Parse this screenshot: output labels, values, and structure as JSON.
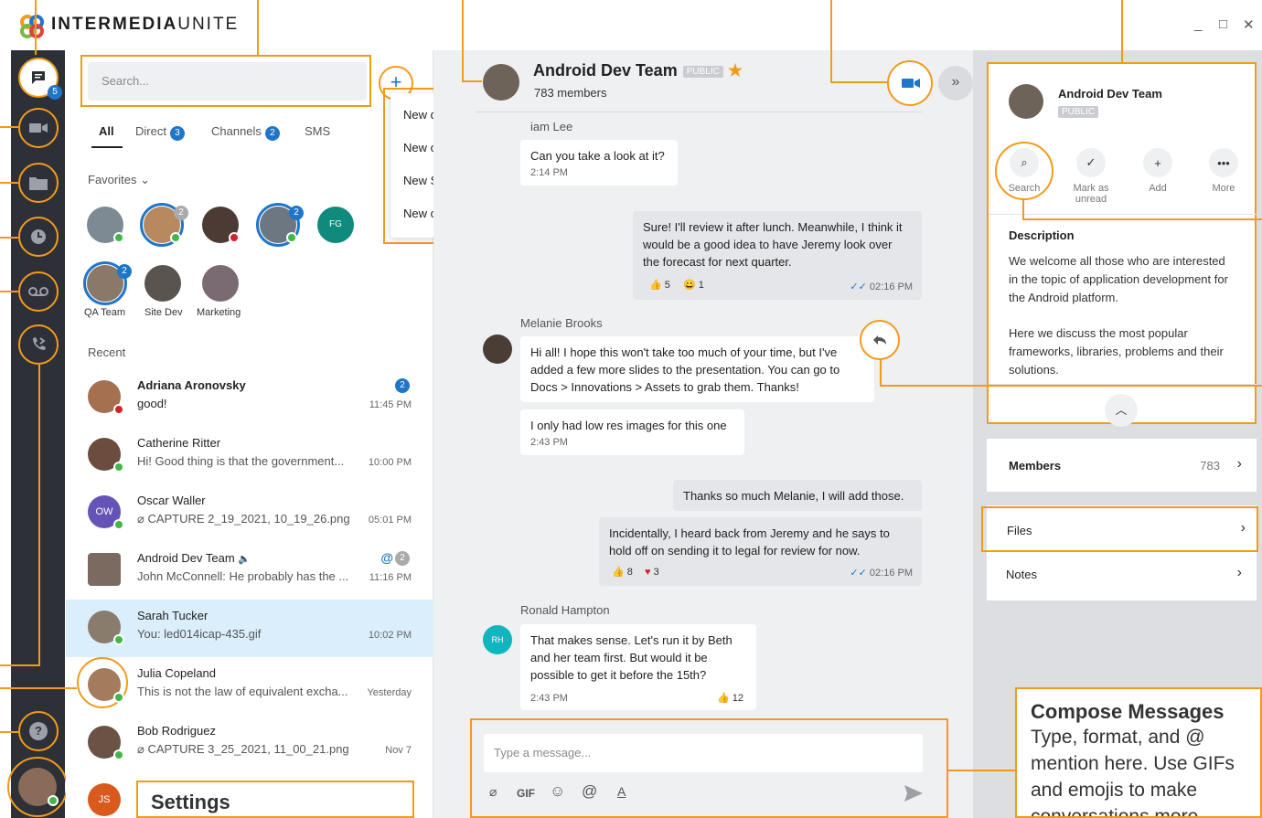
{
  "app": {
    "logo_bold": "INTERMEDIA",
    "logo_light": "UNITE",
    "accent": "#f29a1c",
    "brand_blue": "#1f76c9"
  },
  "rail": {
    "chat_badge": "5",
    "items": [
      "chat-icon",
      "video-icon",
      "folder-icon",
      "history-icon",
      "voicemail-icon",
      "call-forward-icon",
      "help-icon",
      "profile-avatar"
    ]
  },
  "sidebar": {
    "search_placeholder": "Search...",
    "new_button": "+",
    "tabs": [
      {
        "label": "All"
      },
      {
        "label": "Direct",
        "badge": "3"
      },
      {
        "label": "Channels",
        "badge": "2"
      },
      {
        "label": "SMS"
      }
    ],
    "favorites_label": "Favorites",
    "favorites": [
      {
        "initials": "",
        "badge": ""
      },
      {
        "initials": "",
        "badge": "2"
      },
      {
        "initials": "",
        "badge": ""
      },
      {
        "initials": "",
        "badge": "2"
      },
      {
        "initials": "FG",
        "badge": ""
      }
    ],
    "groups": [
      {
        "label": "QA Team",
        "badge": "2"
      },
      {
        "label": "Site Dev",
        "badge": ""
      },
      {
        "label": "Marketing",
        "badge": ""
      }
    ],
    "recent_label": "Recent",
    "recent": [
      {
        "name": "Adriana Aronovsky",
        "message": "good!",
        "time": "11:45 PM",
        "count": "2"
      },
      {
        "name": "Catherine Ritter",
        "message": "Hi! Good thing is that the government...",
        "time": "10:00 PM",
        "count": ""
      },
      {
        "name": "Oscar Waller",
        "message": "CAPTURE 2_19_2021, 10_19_26.png",
        "time": "05:01 PM",
        "count": "",
        "initials": "OW"
      },
      {
        "name": "Android Dev Team",
        "message": "John McConnell: He probably has the ...",
        "time": "11:16 PM",
        "count": "2",
        "mention": "@"
      },
      {
        "name": "Sarah Tucker",
        "message": "You: led014icap-435.gif",
        "time": "10:02 PM",
        "count": ""
      },
      {
        "name": "Julia Copeland",
        "message": "This is not the law of equivalent excha...",
        "time": "Yesterday",
        "count": ""
      },
      {
        "name": "Bob Rodriguez",
        "message": "CAPTURE 3_25_2021, 11_00_21.png",
        "time": "Nov 7",
        "count": ""
      },
      {
        "name": "",
        "message": "",
        "time": "",
        "count": "",
        "initials": "JS"
      }
    ]
  },
  "new_menu": {
    "items": [
      "New direct message",
      "New channel",
      "New SMS",
      "New contact"
    ]
  },
  "chat": {
    "title": "Android Dev Team",
    "tag": "PUBLIC",
    "members": "783 members",
    "messages": [
      {
        "sender": "iam Lee",
        "text": "Can you take a look at it?",
        "time": "2:14 PM"
      },
      {
        "mine": true,
        "text": "Sure! I'll review it after lunch. Meanwhile, I think it would be a good idea to have Jeremy look over the forecast for next quarter.",
        "reactions": [
          "5",
          "1"
        ],
        "time": "02:16 PM"
      },
      {
        "sender": "Melanie Brooks",
        "text": "Hi all! I hope this won't take too much of your time, but I've added a few more slides to the presentation. You can go to Docs > Innovations > Assets to grab them. Thanks!"
      },
      {
        "text": "I only had low res images for this one",
        "time": "2:43 PM"
      },
      {
        "mine": true,
        "text": "Thanks so much Melanie, I will add those."
      },
      {
        "mine": true,
        "text": "Incidentally, I heard back from Jeremy and he says to hold off on sending it to legal for review for now.",
        "reactions": [
          "8",
          "3"
        ],
        "time": "02:16 PM"
      },
      {
        "sender": "Ronald Hampton",
        "initials": "RH",
        "text": "That makes sense. Let's run it by Beth and her team first. But would it be possible to get it before the 15th?",
        "time": "2:43 PM",
        "reactions": [
          "12"
        ]
      }
    ],
    "composer_placeholder": "Type a message...",
    "tools": [
      "GIF"
    ]
  },
  "details": {
    "title": "Android Dev Team",
    "tag": "PUBLIC",
    "actions": [
      {
        "label": "Search"
      },
      {
        "label": "Mark as unread"
      },
      {
        "label": "Add"
      },
      {
        "label": "More"
      }
    ],
    "description_heading": "Description",
    "description_p1": "We welcome all those who are interested in the topic of application development for the Android platform.",
    "description_p2": "Here we discuss the most popular frameworks, libraries, problems and their solutions.",
    "members_label": "Members",
    "members_count": "783",
    "files_label": "Files",
    "notes_label": "Notes"
  },
  "callouts": {
    "compose_title": "Compose Messages",
    "compose_body": "Type, format, and @ mention here. Use GIFs and emojis to make conversations more",
    "settings_title": "Settings"
  }
}
